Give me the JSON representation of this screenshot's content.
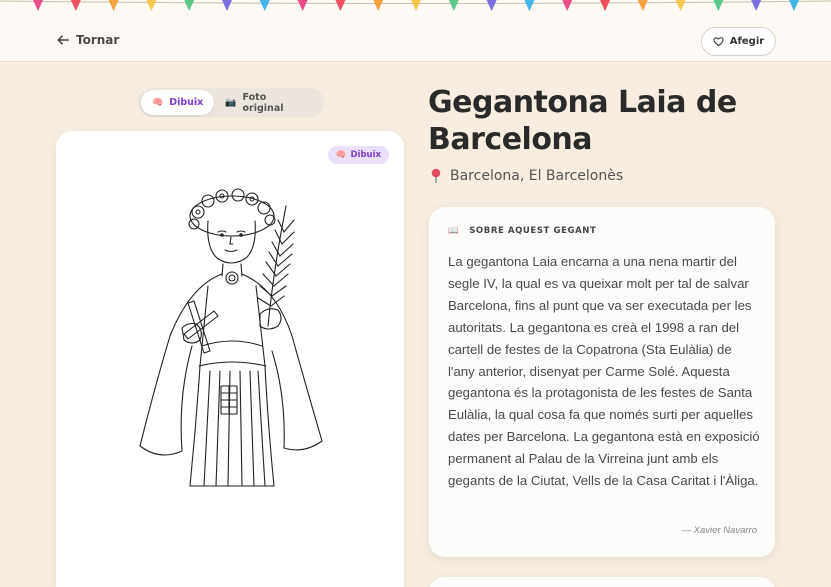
{
  "nav": {
    "back_label": "Tornar",
    "add_label": "Afegir"
  },
  "view_toggle": {
    "options": [
      {
        "label": "Dibuix",
        "icon": "brain-icon",
        "active": true
      },
      {
        "label": "Foto original",
        "icon": "camera-icon",
        "active": false
      }
    ]
  },
  "drawing": {
    "badge_label": "Dibuix",
    "badge_icon": "brain-icon"
  },
  "giant": {
    "title": "Gegantona Laia de Barcelona",
    "location": "Barcelona, El Barcelonès"
  },
  "about": {
    "heading": "SOBRE AQUEST GEGANT",
    "text": "La gegantona Laia encarna a una nena martir del segle IV, la qual es va queixar molt per tal de salvar Barcelona, fins al punt que va ser executada per les autoritats. La gegantona es creà el 1998 a ran del cartell de festes de la Copatrona (Sta Eulàlia) de l'any anterior, disenyat per Carme Solé. Aquesta gegantona és la protagonista de les festes de Santa Eulàlia, la qual cosa fa que només surti per aquelles dates per Barcelona. La gegantona està en exposició permanent al Palau de la Virreina junt amb els gegants de la Ciutat, Vells de la Casa Caritat i l'Àliga.",
    "author": "— Xavier Navarro"
  },
  "colors": {
    "accent": "#7a3fc4",
    "badge_bg": "#ebe0fb",
    "page_bg": "#f7ede0",
    "pennants": [
      "#e84d8a",
      "#ef4f5a",
      "#f4a340",
      "#f2c94c",
      "#5cc98b",
      "#7b6ee0",
      "#3fb6e6"
    ]
  }
}
